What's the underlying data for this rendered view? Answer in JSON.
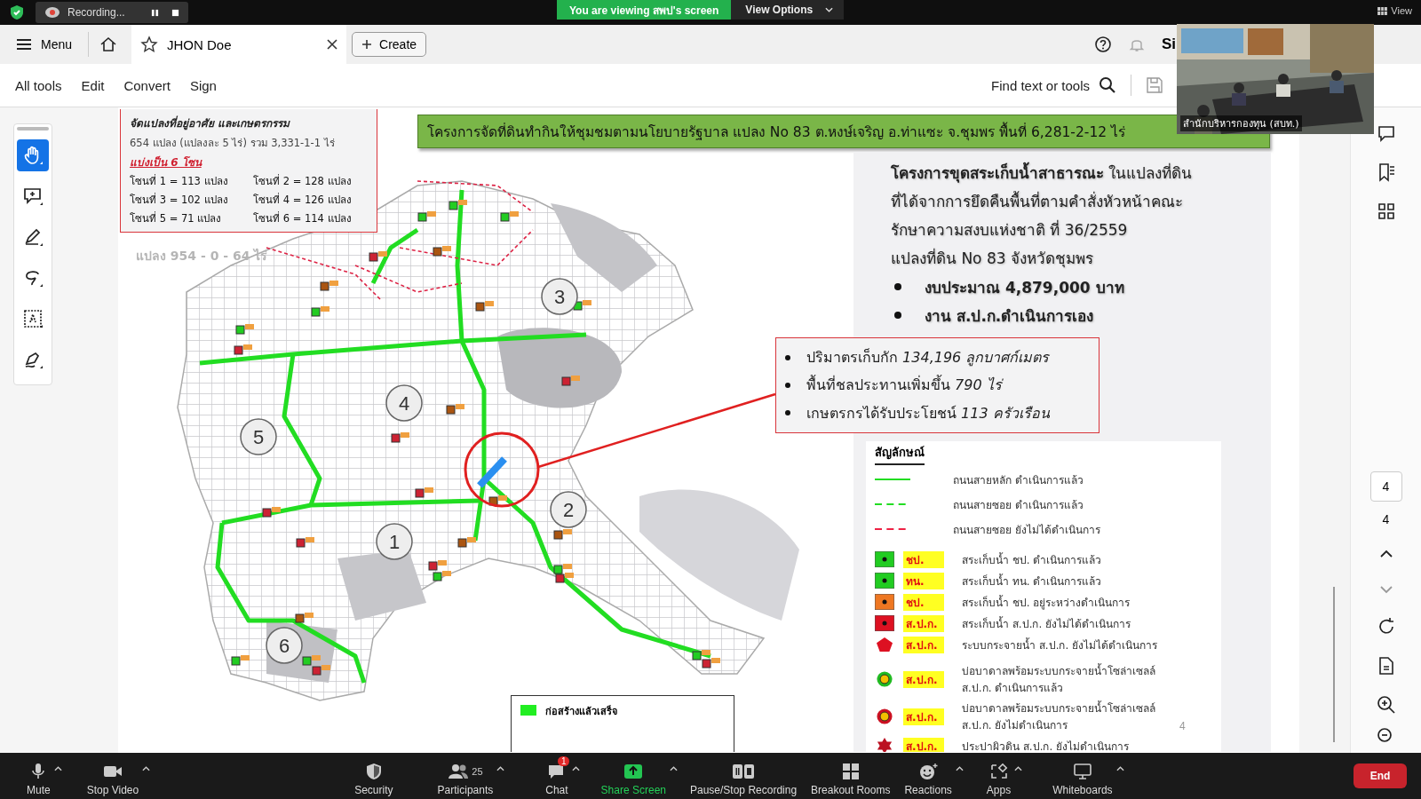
{
  "zoom_top_bar": {
    "recording_label": "Recording...",
    "viewing_banner": "You are viewing สพป's screen",
    "view_options": "View Options",
    "view": "View"
  },
  "tab_bar": {
    "menu": "Menu",
    "tab_title": "JHON Doe",
    "create": "Create",
    "sign_in": "Si"
  },
  "menu_bar": {
    "items": [
      {
        "label": "All tools"
      },
      {
        "label": "Edit"
      },
      {
        "label": "Convert"
      },
      {
        "label": "Sign"
      }
    ],
    "search_label": "Find text or tools"
  },
  "tools": [
    {
      "kind": "hand",
      "selected": true
    },
    {
      "kind": "comment",
      "selected": false
    },
    {
      "kind": "pencil",
      "selected": false
    },
    {
      "kind": "lasso",
      "selected": false
    },
    {
      "kind": "text-select",
      "selected": false
    },
    {
      "kind": "sign",
      "selected": false
    }
  ],
  "document": {
    "info_box": {
      "heading": "จัดแปลงที่อยู่อาศัย และเกษตรกรรม",
      "summary": "654  แปลง (แปลงละ 5  ไร่)  รวม 3,331-1-1  ไร่",
      "split_note": "แบ่งเป็น 6 โซน",
      "zones": [
        "โซนที่  1  =  113 แปลง",
        "โซนที่  2  =  128 แปลง",
        "โซนที่  3  =  102 แปลง",
        "โซนที่  4  =  126 แปลง",
        "โซนที่  5  =  71 แปลง",
        "โซนที่  6  =  114 แปลง"
      ]
    },
    "title": "โครงการจัดที่ดินทำกินให้ชุมชมตามนโยบายรัฐบาล แปลง No 83 ต.หงษ์เจริญ  อ.ท่าแซะ  จ.ชุมพร พื้นที่ 6,281-2-12 ไร่",
    "project_text": {
      "lines": [
        "**โครงการขุดสระเก็บน้ำสาธารณะ** ในแปลงที่ดิน",
        "ที่ได้จากการยึดคืนพื้นที่ตามคำสั่งหัวหน้าคณะ",
        "รักษาความสงบแห่งชาติ ที่ 36/2559",
        "แปลงที่ดิน No 83 จังหวัดชุมพร"
      ],
      "bullets": [
        "งบประมาณ 4,879,000 บาท",
        "งาน ส.ป.ก.ดำเนินการเอง"
      ]
    },
    "callout": {
      "bullets": [
        "ปริมาตรเก็บกัก *134,196 ลูกบาศก์เมตร*",
        "พื้นที่ชลประทานเพิ่มขึ้น *790 ไร่*",
        "เกษตรกรได้รับประโยชน์ *113 ครัวเรือน*"
      ]
    },
    "map": {
      "plot_label": "แปลง 954 - 0 - 64 ไร่",
      "zones": [
        {
          "label": "3"
        },
        {
          "label": "4"
        },
        {
          "label": "5"
        },
        {
          "label": "1"
        },
        {
          "label": "2"
        },
        {
          "label": "6"
        }
      ],
      "bottom_legend": "ก่อสร้างแล้วเสร็จ"
    },
    "legend": {
      "title": "สัญลักษณ์",
      "items": [
        {
          "kind": "solid-line",
          "color": "#22dd22",
          "label": "ถนนสายหลัก ดำเนินการแล้ว"
        },
        {
          "kind": "dashed-line",
          "color": "#22dd22",
          "label": "ถนนสายซอย ดำเนินการแล้ว"
        },
        {
          "kind": "dashed-line",
          "color": "#ee2244",
          "label": "ถนนสายซอย ยังไม่ได้ดำเนินการ"
        },
        {
          "kind": "square",
          "color": "#22cc22",
          "tag": "ชป.",
          "label": "สระเก็บน้ำ ชป. ดำเนินการแล้ว"
        },
        {
          "kind": "square",
          "color": "#22cc22",
          "tag": "ทน.",
          "label": "สระเก็บน้ำ ทน. ดำเนินการแล้ว"
        },
        {
          "kind": "square",
          "color": "#ee7722",
          "tag": "ชป.",
          "label": "สระเก็บน้ำ ชป. อยู่ระหว่างดำเนินการ"
        },
        {
          "kind": "square",
          "color": "#dd1122",
          "tag": "ส.ป.ก.",
          "label": "สระเก็บน้ำ ส.ป.ก. ยังไม่ได้ดำเนินการ"
        },
        {
          "kind": "pentagon",
          "color": "#dd1122",
          "tag": "ส.ป.ก.",
          "label": "ระบบกระจายน้ำ ส.ป.ก. ยังไม่ได้ดำเนินการ"
        },
        {
          "kind": "circle-s",
          "color": "#22bb22",
          "tag": "ส.ป.ก.",
          "label": "บ่อบาดาลพร้อมระบบกระจายน้ำโซล่าเซลล์",
          "sublabel": "ส.ป.ก. ดำเนินการแล้ว"
        },
        {
          "kind": "circle-s",
          "color": "#cc1122",
          "tag": "ส.ป.ก.",
          "label": "บ่อบาดาลพร้อมระบบกระจายน้ำโซล่าเซลล์",
          "sublabel": "ส.ป.ก. ยังไม่ดำเนินการ"
        },
        {
          "kind": "star",
          "color": "#bb1122",
          "tag": "ส.ป.ก.",
          "label": "ประปาผิวดิน ส.ป.ก. ยังไม่ดำเนินการ"
        }
      ]
    },
    "page_mark": "4"
  },
  "video_thumbnail": {
    "caption": "สำนักบริหารกองทุน (สบท.)"
  },
  "right_panel": {
    "page_number": "4",
    "page_count": "4"
  },
  "bottom_toolbar": {
    "buttons": [
      {
        "kind": "mic",
        "label": "Mute",
        "has_menu": true
      },
      {
        "kind": "video",
        "label": "Stop Video",
        "has_menu": true
      },
      {
        "kind": "security",
        "label": "Security",
        "has_menu": false
      },
      {
        "kind": "participants",
        "label": "Participants",
        "count": "25",
        "has_menu": true
      },
      {
        "kind": "chat",
        "label": "Chat",
        "badge": "1",
        "has_menu": true
      },
      {
        "kind": "share",
        "label": "Share Screen",
        "has_menu": true
      },
      {
        "kind": "record",
        "label": "Pause/Stop Recording",
        "has_menu": false
      },
      {
        "kind": "breakout",
        "label": "Breakout Rooms",
        "has_menu": false
      },
      {
        "kind": "reactions",
        "label": "Reactions",
        "has_menu": true
      },
      {
        "kind": "apps",
        "label": "Apps",
        "has_menu": true
      },
      {
        "kind": "whiteboards",
        "label": "Whiteboards",
        "has_menu": true
      }
    ],
    "end": "End"
  }
}
